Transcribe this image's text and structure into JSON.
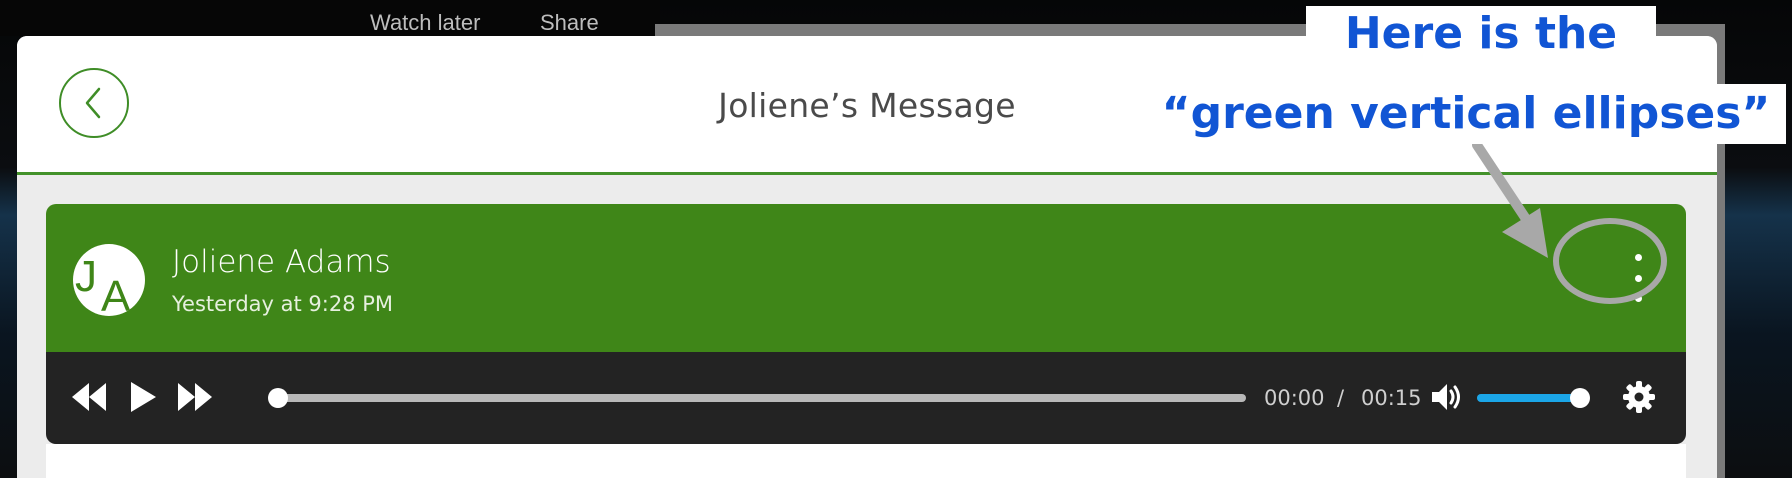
{
  "background": {
    "video_actions": [
      "Watch later",
      "Share"
    ]
  },
  "modal": {
    "title": "Joliene’s Message",
    "back_icon": "chevron-left-icon"
  },
  "message": {
    "avatar_initials": [
      "J",
      "A"
    ],
    "sender_name": "Joliene Adams",
    "timestamp": "Yesterday at 9:28 PM",
    "more_icon": "vertical-ellipsis-icon"
  },
  "player": {
    "current_time": "00:00",
    "separator": "/",
    "total_time": "00:15",
    "progress": 0,
    "volume": 0.95,
    "icons": [
      "rewind-icon",
      "play-icon",
      "fast-forward-icon",
      "volume-icon",
      "settings-gear-icon"
    ]
  },
  "annotation": {
    "line1": "Here is the",
    "line2": "“green vertical ellipses”"
  },
  "colors": {
    "brand_green": "#3f8618",
    "annotation_blue": "#1155d4",
    "player_bg": "#232323",
    "volume_accent": "#1ba6e8"
  }
}
